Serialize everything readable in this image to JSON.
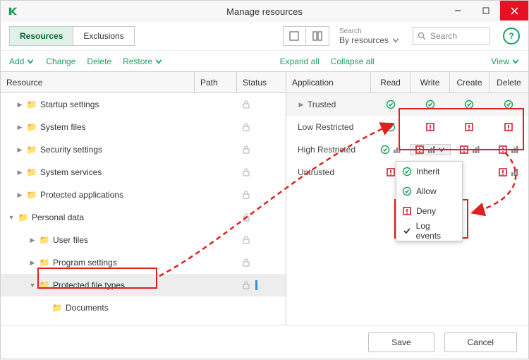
{
  "title": "Manage resources",
  "tabs": {
    "resources": "Resources",
    "exclusions": "Exclusions"
  },
  "toolbar": {
    "searchLabel": "Search",
    "searchDropdown": "By resources",
    "searchPlaceholder": "Search"
  },
  "actions": {
    "add": "Add",
    "change": "Change",
    "delete": "Delete",
    "restore": "Restore",
    "expand": "Expand all",
    "collapse": "Collapse all",
    "view": "View"
  },
  "headers": {
    "resource": "Resource",
    "path": "Path",
    "status": "Status",
    "application": "Application",
    "read": "Read",
    "write": "Write",
    "create": "Create",
    "delete": "Delete"
  },
  "tree": {
    "r0": "Startup settings",
    "r1": "System files",
    "r2": "Security settings",
    "r3": "System services",
    "r4": "Protected applications",
    "r5": "Personal data",
    "r6": "User files",
    "r7": "Program settings",
    "r8": "Protected file types",
    "r9": "Documents"
  },
  "apps": {
    "a0": "Trusted",
    "a1": "Low Restricted",
    "a2": "High Restricted",
    "a3": "Untrusted"
  },
  "menu": {
    "inherit": "Inherit",
    "allow": "Allow",
    "deny": "Deny",
    "log": "Log events"
  },
  "buttons": {
    "save": "Save",
    "cancel": "Cancel"
  }
}
